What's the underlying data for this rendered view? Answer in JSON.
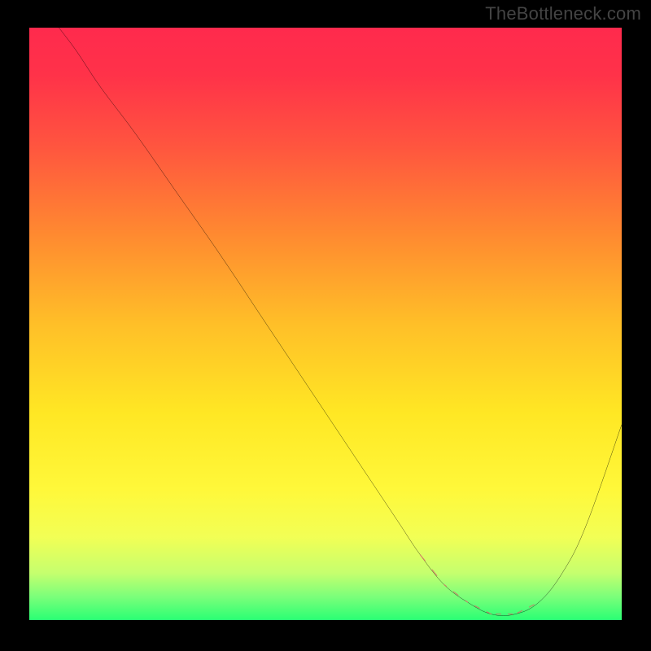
{
  "watermark": "TheBottleneck.com",
  "chart_data": {
    "type": "line",
    "title": "",
    "xlabel": "",
    "ylabel": "",
    "xlim": [
      0,
      100
    ],
    "ylim": [
      0,
      100
    ],
    "series": [
      {
        "name": "curve",
        "color": "#000000",
        "x": [
          5,
          8,
          12,
          18,
          25,
          32,
          40,
          48,
          56,
          62,
          66,
          70,
          74,
          78,
          82,
          86,
          90,
          94,
          100
        ],
        "y": [
          100,
          96,
          90,
          82,
          72,
          62,
          50,
          38,
          26,
          17,
          11,
          6,
          3,
          1,
          1,
          3,
          8,
          16,
          33
        ]
      },
      {
        "name": "highlight-segment",
        "color": "#d66a66",
        "x": [
          66,
          70,
          74,
          78,
          82,
          86
        ],
        "y": [
          11,
          6,
          3,
          1,
          1,
          3
        ]
      }
    ],
    "gradient_stops": [
      {
        "offset": 0.0,
        "color": "#ff2a4d"
      },
      {
        "offset": 0.08,
        "color": "#ff3249"
      },
      {
        "offset": 0.2,
        "color": "#ff553f"
      },
      {
        "offset": 0.35,
        "color": "#ff8a30"
      },
      {
        "offset": 0.5,
        "color": "#ffbf28"
      },
      {
        "offset": 0.65,
        "color": "#ffe724"
      },
      {
        "offset": 0.78,
        "color": "#fff83a"
      },
      {
        "offset": 0.86,
        "color": "#f2ff55"
      },
      {
        "offset": 0.92,
        "color": "#c6ff6e"
      },
      {
        "offset": 0.96,
        "color": "#7cff7a"
      },
      {
        "offset": 1.0,
        "color": "#2aff74"
      }
    ]
  }
}
